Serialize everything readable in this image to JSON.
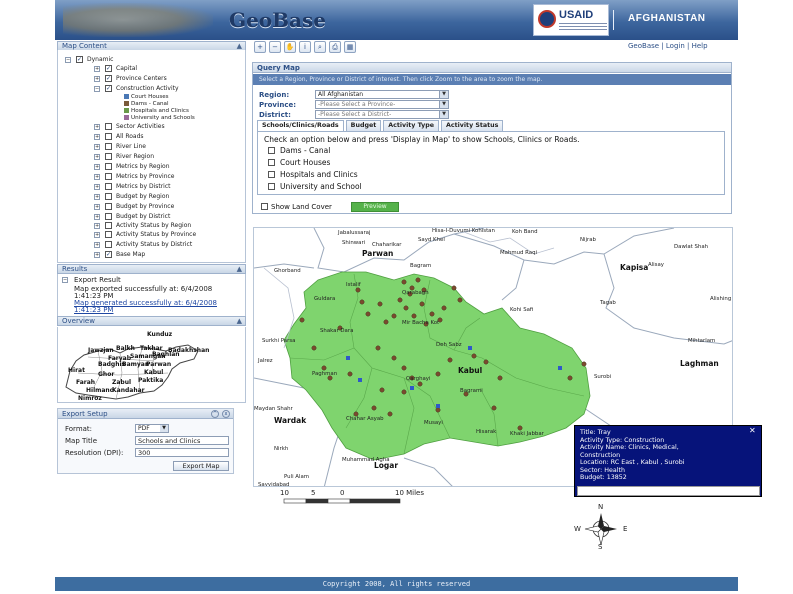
{
  "header": {
    "logo_text": "GeoBase",
    "usaid_text": "USAID",
    "country": "AFGHANISTAN"
  },
  "top_links": {
    "geobase": "GeoBase",
    "login": "Login",
    "help": "Help"
  },
  "toolbar": {
    "tools": [
      "zoom-in",
      "zoom-out",
      "pan",
      "identify",
      "search",
      "print",
      "select"
    ],
    "glyphs": [
      "+",
      "−",
      "✋",
      "i",
      "⌕",
      "⎙",
      "▦"
    ]
  },
  "map_content": {
    "title": "Map Content",
    "tree": [
      {
        "label": "Dynamic",
        "indent": 0,
        "expander": "−",
        "checked": true
      },
      {
        "label": "Capital",
        "indent": 1,
        "expander": "+",
        "checked": true
      },
      {
        "label": "Province Centers",
        "indent": 1,
        "expander": "+",
        "checked": true
      },
      {
        "label": "Construction Activity",
        "indent": 1,
        "expander": "−",
        "checked": true
      },
      {
        "label": "Sector Activities",
        "indent": 1,
        "expander": "+",
        "checked": false,
        "offset": 4
      },
      {
        "label": "All Roads",
        "indent": 1,
        "expander": "+",
        "checked": false,
        "offset": 4
      },
      {
        "label": "River Line",
        "indent": 1,
        "expander": "+",
        "checked": false,
        "offset": 4
      },
      {
        "label": "River Region",
        "indent": 1,
        "expander": "+",
        "checked": false,
        "offset": 4
      },
      {
        "label": "Metrics by Region",
        "indent": 1,
        "expander": "+",
        "checked": false,
        "offset": 4
      },
      {
        "label": "Metrics by Province",
        "indent": 1,
        "expander": "+",
        "checked": false,
        "offset": 4
      },
      {
        "label": "Metrics by District",
        "indent": 1,
        "expander": "+",
        "checked": false,
        "offset": 4
      },
      {
        "label": "Budget by Region",
        "indent": 1,
        "expander": "+",
        "checked": false,
        "offset": 4
      },
      {
        "label": "Budget by Province",
        "indent": 1,
        "expander": "+",
        "checked": false,
        "offset": 4
      },
      {
        "label": "Budget by District",
        "indent": 1,
        "expander": "+",
        "checked": false,
        "offset": 4
      },
      {
        "label": "Activity Status by Region",
        "indent": 1,
        "expander": "+",
        "checked": false,
        "offset": 4
      },
      {
        "label": "Activity Status by Province",
        "indent": 1,
        "expander": "+",
        "checked": false,
        "offset": 4
      },
      {
        "label": "Activity Status by District",
        "indent": 1,
        "expander": "+",
        "checked": false,
        "offset": 4
      },
      {
        "label": "Base Map",
        "indent": 1,
        "expander": "+",
        "checked": true,
        "offset": 4
      }
    ],
    "legend": [
      {
        "label": "Court Houses",
        "color": "#4a78b5"
      },
      {
        "label": "Dams - Canal",
        "color": "#7a5a3a"
      },
      {
        "label": "Hospitals and Clinics",
        "color": "#6a9a4a"
      },
      {
        "label": "University and Schools",
        "color": "#9a6a9a"
      }
    ]
  },
  "results": {
    "title": "Results",
    "group": "Export Result",
    "line1": "Map exported successfully at: 6/4/2008",
    "line1b": "1:41:23 PM",
    "line2": "Map generated successfully at: 6/4/2008",
    "line2b": "1:41:23 PM"
  },
  "overview": {
    "title": "Overview",
    "labels": [
      "Kunduz",
      "Jawzjan",
      "Balkh",
      "Takhar",
      "Badakhshan",
      "Faryab",
      "Samangan",
      "Baghlan",
      "Badghis",
      "Bamyan",
      "Parwan",
      "Hirat",
      "Ghor",
      "Kabul",
      "Farah",
      "Zabul",
      "Paktika",
      "Hilmand",
      "Kandahar",
      "Nimroz"
    ]
  },
  "export_setup": {
    "title": "Export Setup",
    "format_label": "Format:",
    "format_value": "PDF",
    "title_label": "Map Title",
    "title_value": "Schools and Clinics",
    "resolution_label": "Resolution (DPI):",
    "resolution_value": "300",
    "button": "Export Map"
  },
  "query": {
    "title": "Query Map",
    "instruction": "Select a Region, Province or District of interest. Then click Zoom to the area to zoom the map.",
    "region_label": "Region:",
    "region_value": "All Afghanistan",
    "province_label": "Province:",
    "province_value": "-Please Select a Province-",
    "district_label": "District:",
    "district_value": "-Please Select a District-",
    "tabs": [
      "Schools/Clinics/Roads",
      "Budget",
      "Activity Type",
      "Activity Status"
    ],
    "tab_instruction": "Check an option below and press 'Display in Map' to show Schools, Clinics or Roads.",
    "options": [
      "Dams - Canal",
      "Court Houses",
      "Hospitals and Clinics",
      "University and School"
    ],
    "land_cover": "Show Land Cover",
    "preview": "Preview"
  },
  "map": {
    "labels": [
      {
        "text": "Jabalussaraj",
        "c": "#222"
      },
      {
        "text": "Hisa-I-Duvumi Kohistan",
        "c": "#222"
      },
      {
        "text": "Koh Band",
        "c": "#222"
      },
      {
        "text": "Shinwari",
        "c": "#222"
      },
      {
        "text": "Chaharikar",
        "c": "#222"
      },
      {
        "text": "Sayd Khel",
        "c": "#222"
      },
      {
        "text": "Nijrab",
        "c": "#222"
      },
      {
        "text": "Dawlat Shah",
        "c": "#222"
      },
      {
        "text": "Parwan",
        "c": "#111",
        "bold": true
      },
      {
        "text": "Mahmud Raqi",
        "c": "#222"
      },
      {
        "text": "Bagram",
        "c": "#222"
      },
      {
        "text": "Kapisa",
        "c": "#111",
        "bold": true
      },
      {
        "text": "Alisay",
        "c": "#222"
      },
      {
        "text": "Ghorband",
        "c": "#222"
      },
      {
        "text": "Tagab",
        "c": "#222"
      },
      {
        "text": "Alishing",
        "c": "#222"
      },
      {
        "text": "Istalif",
        "c": "#222"
      },
      {
        "text": "Guldara",
        "c": "#222"
      },
      {
        "text": "Qarabagh",
        "c": "#222"
      },
      {
        "text": "Kohi Safi",
        "c": "#222"
      },
      {
        "text": "Mihtarlam",
        "c": "#222"
      },
      {
        "text": "Shakar Dara",
        "c": "#222"
      },
      {
        "text": "Mir Bacha Kot",
        "c": "#222"
      },
      {
        "text": "Surkhi Parsa",
        "c": "#222"
      },
      {
        "text": "Deh Sabz",
        "c": "#222"
      },
      {
        "text": "Laghman",
        "c": "#111",
        "bold": true
      },
      {
        "text": "Jalrez",
        "c": "#222"
      },
      {
        "text": "Paghman",
        "c": "#222"
      },
      {
        "text": "Kabul",
        "c": "#111",
        "bold": true
      },
      {
        "text": "Surobi",
        "c": "#222"
      },
      {
        "text": "Qarghayi",
        "c": "#222"
      },
      {
        "text": "Bagrami",
        "c": "#222"
      },
      {
        "text": "Maydan Shahr",
        "c": "#222"
      },
      {
        "text": "Wardak",
        "c": "#111",
        "bold": true
      },
      {
        "text": "Chahar Asyab",
        "c": "#222"
      },
      {
        "text": "Musayi",
        "c": "#222"
      },
      {
        "text": "Hisarak",
        "c": "#222"
      },
      {
        "text": "Khaki Jabbar",
        "c": "#222"
      },
      {
        "text": "Nirkh",
        "c": "#222"
      },
      {
        "text": "Muhammad Agha",
        "c": "#222"
      },
      {
        "text": "Logar",
        "c": "#111",
        "bold": true
      },
      {
        "text": "Puli Alam",
        "c": "#222"
      },
      {
        "text": "Sayyidabad",
        "c": "#222"
      }
    ],
    "scale_ticks": [
      "10",
      "5",
      "0",
      "10 Miles"
    ],
    "compass": {
      "n": "N",
      "s": "S",
      "e": "E",
      "w": "W"
    }
  },
  "popup": {
    "title": "Title: Tray",
    "activity_type": "Activity Type: Construction",
    "activity_name": "Activity Name: Clinics, Medical,",
    "activity_name2": "Construction",
    "location": "Location: RC East , Kabul , Surobi",
    "sector": "Sector: Health",
    "budget": "Budget: 13852",
    "close": "✕"
  },
  "footer": {
    "text": "Copyright 2008, All rights reserved"
  },
  "colors": {
    "header": "#3d669e",
    "district": "#7fd46e",
    "popup_bg": "#06137a",
    "footer": "#3d6da0",
    "link": "#2c4f86"
  }
}
